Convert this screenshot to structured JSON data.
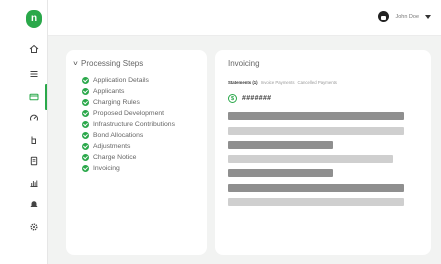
{
  "app": {
    "logo_letter": "n"
  },
  "sidebar": {
    "items": [
      {
        "icon": "home-icon"
      },
      {
        "icon": "list-icon"
      },
      {
        "icon": "card-icon",
        "active": true
      },
      {
        "icon": "gauge-icon"
      },
      {
        "icon": "pointer-icon"
      },
      {
        "icon": "document-icon"
      },
      {
        "icon": "bar-chart-icon"
      },
      {
        "icon": "bell-icon"
      },
      {
        "icon": "gear-icon"
      }
    ]
  },
  "topbar": {
    "user_name": "John Doe"
  },
  "steps": {
    "title": "Processing Steps",
    "items": [
      "Application Details",
      "Applicants",
      "Charging Rules",
      "Proposed Development",
      "Infrastructure Contributions",
      "Bond Allocations",
      "Adjustments",
      "Charge Notice",
      "Invoicing"
    ]
  },
  "invoicing": {
    "title": "Invoicing",
    "tabs": [
      "Statements (1)",
      "Invoice Payments",
      "Cancelled Payments"
    ],
    "currency_symbol": "$",
    "amount": "#######"
  },
  "colors": {
    "accent": "#2aa84a",
    "bar_dark": "#8f8f8f",
    "bar_light": "#cfcfcf"
  }
}
